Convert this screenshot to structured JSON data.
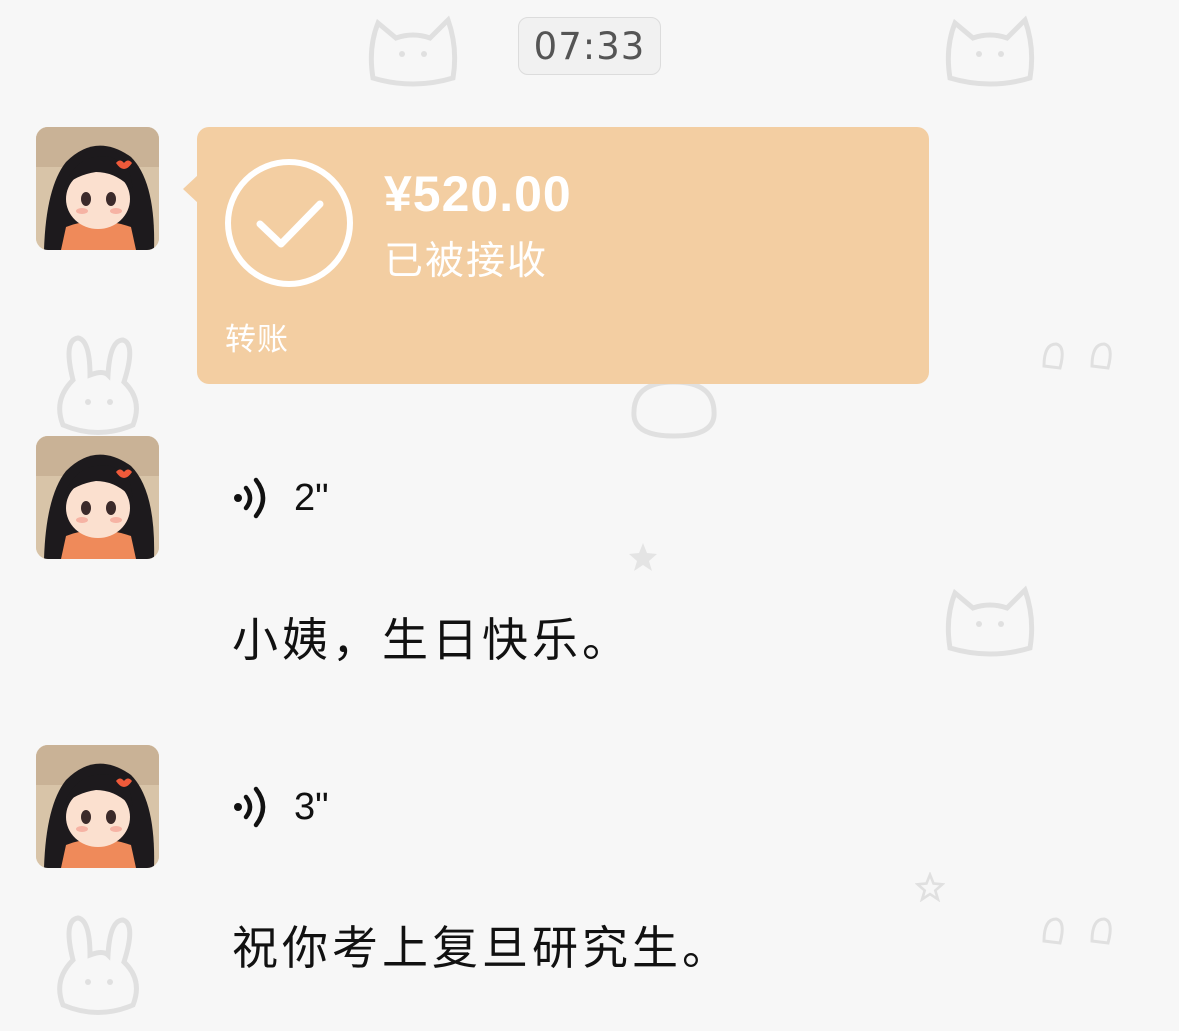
{
  "chat": {
    "timestamp": "07:33",
    "messages": [
      {
        "type": "transfer",
        "amount": "¥520.00",
        "status": "已被接收",
        "label": "转账",
        "icon": "check-circle-icon",
        "color": "#f3cea2"
      },
      {
        "type": "voice",
        "icon": "voice-wave-icon",
        "duration": "2\"",
        "transcript": "小姨，生日快乐。"
      },
      {
        "type": "voice",
        "icon": "voice-wave-icon",
        "duration": "3\"",
        "transcript": "祝你考上复旦研究生。"
      }
    ]
  }
}
